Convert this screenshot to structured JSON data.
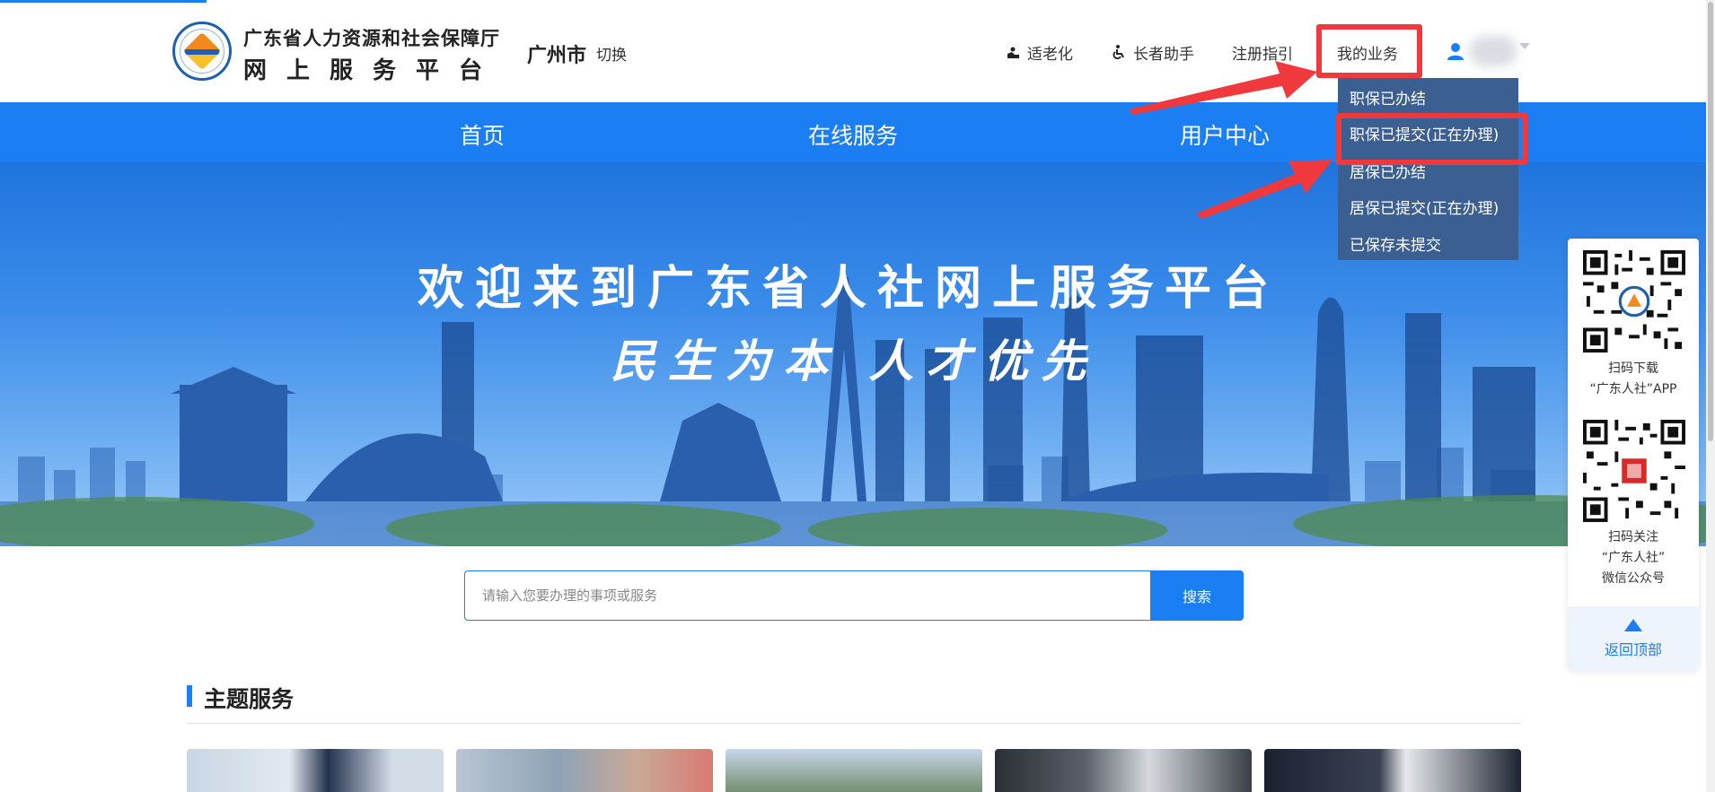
{
  "header": {
    "org_name": "广东省人力资源和社会保障厅",
    "platform_name": "网上服务平台",
    "city": "广州市",
    "switch_label": "切换",
    "links": {
      "elder": "适老化",
      "helper": "长者助手",
      "guide": "注册指引",
      "mybiz": "我的业务"
    }
  },
  "nav": {
    "home": "首页",
    "online": "在线服务",
    "user": "用户中心"
  },
  "dropdown": {
    "items": [
      "职保已办结",
      "职保已提交(正在办理)",
      "居保已办结",
      "居保已提交(正在办理)",
      "已保存未提交"
    ]
  },
  "banner": {
    "title": "欢迎来到广东省人社网上服务平台",
    "slogan": "民生为本  人才优先"
  },
  "search": {
    "placeholder": "请输入您要办理的事项或服务",
    "button": "搜索"
  },
  "theme": {
    "title": "主题服务"
  },
  "float_panel": {
    "app_caption_line1": "扫码下载",
    "app_caption_line2": "“广东人社”APP",
    "wechat_caption_line1": "扫码关注",
    "wechat_caption_line2": "“广东人社”",
    "wechat_caption_line3": "微信公众号",
    "back_top": "返回顶部"
  },
  "colors": {
    "brand_blue": "#1b7ef3",
    "dropdown_bg": "#3c5f91",
    "annotation_red": "#f0393d"
  }
}
